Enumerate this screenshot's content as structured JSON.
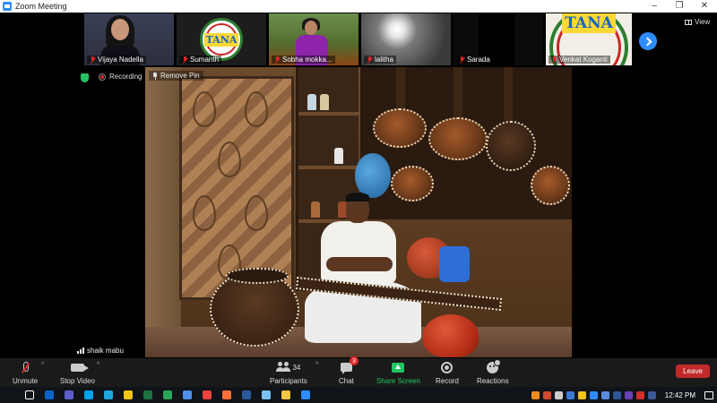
{
  "window": {
    "title": "Zoom Meeting",
    "controls": [
      "–",
      "❐",
      "✕"
    ]
  },
  "view_button": {
    "label": "View"
  },
  "participants_strip": [
    {
      "name": "Vijaya Nadella",
      "muted": true
    },
    {
      "name": "Sumanth",
      "muted": true
    },
    {
      "name": "Sobha mokka...",
      "muted": true
    },
    {
      "name": "lalitha",
      "muted": true
    },
    {
      "name": "Sarada",
      "muted": true
    },
    {
      "name": "Venkat Koganti",
      "muted": true
    }
  ],
  "logo_text": "TANA",
  "recording_label": "Recording",
  "main_video": {
    "remove_pin_label": "Remove Pin",
    "speaker_name": "shaik mabu"
  },
  "toolbar": {
    "unmute_label": "Unmute",
    "stop_video_label": "Stop Video",
    "participants_label": "Participants",
    "participants_count": "34",
    "chat_label": "Chat",
    "chat_badge": "3",
    "share_screen_label": "Share Screen",
    "record_label": "Record",
    "reactions_label": "Reactions",
    "leave_label": "Leave"
  },
  "taskbar": {
    "clock": "12:42 PM",
    "apps": [
      {
        "name": "outlook",
        "color": "#0a64c8"
      },
      {
        "name": "teams",
        "color": "#5b5fc7"
      },
      {
        "name": "skype",
        "color": "#00a2ed"
      },
      {
        "name": "edge",
        "color": "#1ea7e1"
      },
      {
        "name": "store",
        "color": "#f0c419"
      },
      {
        "name": "excel",
        "color": "#1f7244"
      },
      {
        "name": "sheets",
        "color": "#2aa65a"
      },
      {
        "name": "photos",
        "color": "#4f8fe6"
      },
      {
        "name": "chrome",
        "color": "#e8453c"
      },
      {
        "name": "firefox",
        "color": "#ff7139"
      },
      {
        "name": "word",
        "color": "#2b579a"
      },
      {
        "name": "files",
        "color": "#7bc2f3"
      },
      {
        "name": "explorer",
        "color": "#f2c744"
      },
      {
        "name": "zoom",
        "color": "#2d8cff"
      }
    ],
    "tray": [
      {
        "name": "tray-app-1",
        "color": "#f28b1f"
      },
      {
        "name": "tray-app-2",
        "color": "#d34b2f"
      },
      {
        "name": "tray-app-3",
        "color": "#cccccc"
      },
      {
        "name": "tray-app-4",
        "color": "#3a78d6"
      },
      {
        "name": "tray-app-5",
        "color": "#f0c419"
      },
      {
        "name": "tray-app-6",
        "color": "#2d8cff"
      },
      {
        "name": "tray-app-7",
        "color": "#5a8de0"
      },
      {
        "name": "tray-app-8",
        "color": "#2b579a"
      },
      {
        "name": "tray-app-9",
        "color": "#6a3fb5"
      },
      {
        "name": "tray-app-10",
        "color": "#d32f2f"
      },
      {
        "name": "tray-app-11",
        "color": "#3b5998"
      }
    ]
  },
  "colors": {
    "zoom_blue": "#2d8cff",
    "leave_red": "#c02a2a",
    "share_green": "#23c562",
    "mute_red": "#e02828"
  }
}
